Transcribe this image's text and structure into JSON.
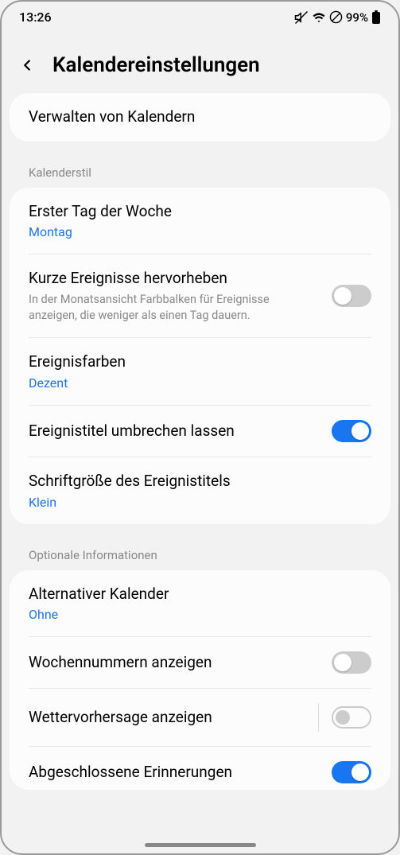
{
  "status": {
    "time": "13:26",
    "battery": "99%"
  },
  "header": {
    "title": "Kalendereinstellungen"
  },
  "manage": {
    "label": "Verwalten von Kalendern"
  },
  "sections": {
    "style": {
      "label": "Kalenderstil",
      "firstDay": {
        "title": "Erster Tag der Woche",
        "value": "Montag"
      },
      "highlight": {
        "title": "Kurze Ereignisse hervorheben",
        "desc": "In der Monatsansicht Farbbalken für Ereignisse anzeigen, die weniger als einen Tag dauern."
      },
      "colors": {
        "title": "Ereignisfarben",
        "value": "Dezent"
      },
      "wrap": {
        "title": "Ereignistitel umbrechen lassen"
      },
      "fontSize": {
        "title": "Schriftgröße des Ereignistitels",
        "value": "Klein"
      }
    },
    "optional": {
      "label": "Optionale Informationen",
      "altCal": {
        "title": "Alternativer Kalender",
        "value": "Ohne"
      },
      "weekNum": {
        "title": "Wochennummern anzeigen"
      },
      "weather": {
        "title": "Wettervorhersage anzeigen"
      },
      "completed": {
        "title": "Abgeschlossene Erinnerungen"
      }
    }
  }
}
